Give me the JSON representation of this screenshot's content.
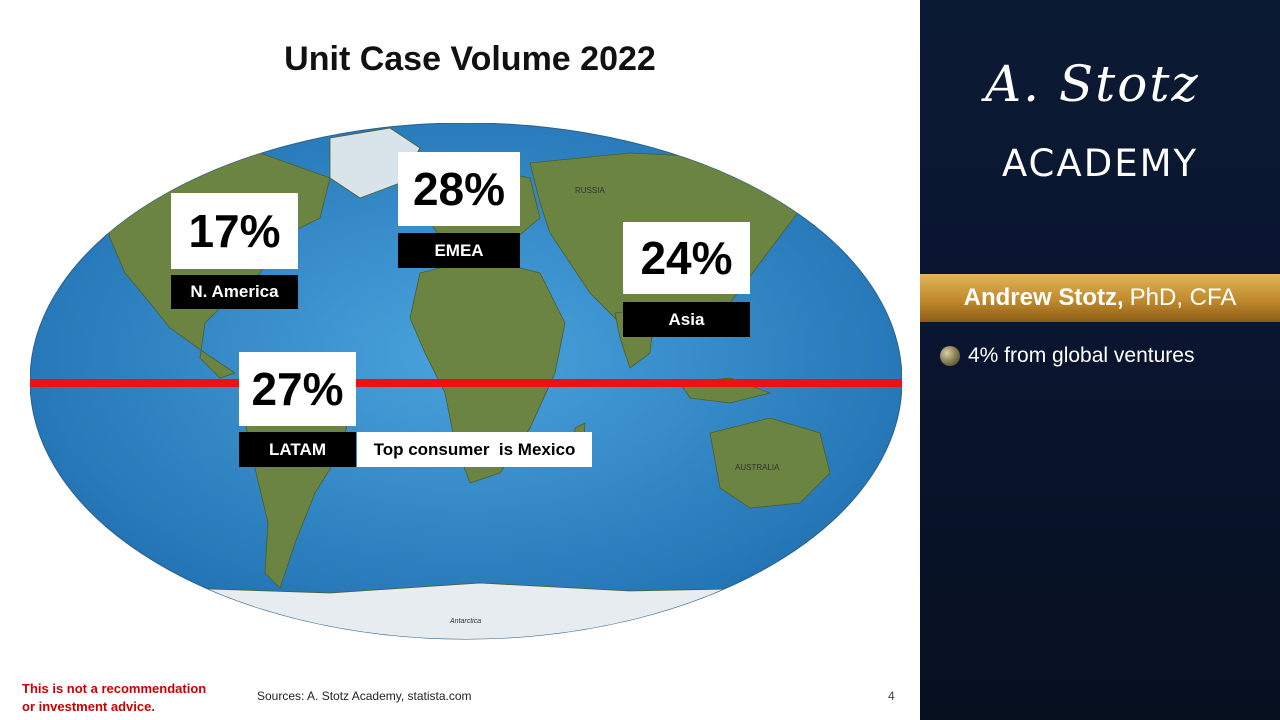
{
  "slide": {
    "title": "Unit Case Volume 2022",
    "regions": [
      {
        "id": "n-america",
        "percent": "17%",
        "label": "N. America"
      },
      {
        "id": "emea",
        "percent": "28%",
        "label": "EMEA"
      },
      {
        "id": "asia",
        "percent": "24%",
        "label": "Asia"
      },
      {
        "id": "latam",
        "percent": "27%",
        "label": "LATAM",
        "note": "Top consumer  is Mexico"
      }
    ],
    "map_labels": {
      "russia": "RUSSIA",
      "australia": "AUSTRALIA",
      "antarctica": "Antarctica"
    },
    "disclaimer": [
      "This is not a recommendation",
      "or investment advice."
    ],
    "sources": "Sources: A. Stotz Academy, statista.com",
    "page_number": "4"
  },
  "sidebar": {
    "logo_script": "A. Stotz",
    "logo_academy": "ACADEMY",
    "presenter_name": "Andrew Stotz,",
    "presenter_credentials": "PhD, CFA",
    "bullets": [
      "4% from global ventures"
    ]
  },
  "colors": {
    "ocean": "#2f86c6",
    "land": "#5f7a3c",
    "equator": "#ee1111",
    "sidebar_bg": "#0b1a33",
    "name_band": "#c08a2c",
    "disclaimer": "#cc0000"
  },
  "icons": [
    "globe-bullet-icon"
  ]
}
